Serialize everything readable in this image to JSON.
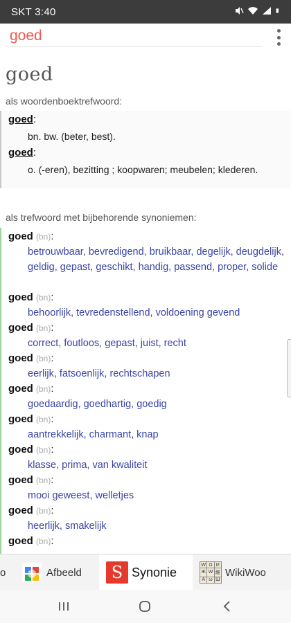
{
  "status": {
    "time": "SKT 3:40",
    "icons": [
      "mute-icon",
      "wifi-icon",
      "signal-icon",
      "battery-icon"
    ]
  },
  "appbar": {
    "search_query": "goed",
    "menu_icon": "more-vert-icon"
  },
  "headword": "goed",
  "dictionary": {
    "label": "als woordenboektrefwoord:",
    "entries": [
      {
        "term": "goed",
        "colon": ":",
        "definition": "bn. bw. (beter, best)."
      },
      {
        "term": "goed",
        "colon": ":",
        "definition": "o. (-eren), bezitting ; koopwaren; meubelen; klederen."
      }
    ]
  },
  "synonyms": {
    "label": "als trefwoord met bijbehorende synoniemen:",
    "groups": [
      {
        "term": "goed",
        "pos": "(bn)",
        "colon": ":",
        "synonyms": "betrouwbaar, bevredigend, bruikbaar, degelijk, deugdelijk, geldig, gepast, geschikt, handig, passend, proper, solide"
      },
      {
        "term": "goed",
        "pos": "(bn)",
        "colon": ":",
        "synonyms": "behoorlijk, tevredenstellend, voldoening gevend"
      },
      {
        "term": "goed",
        "pos": "(bn)",
        "colon": ":",
        "synonyms": "correct, foutloos, gepast, juist, recht"
      },
      {
        "term": "goed",
        "pos": "(bn)",
        "colon": ":",
        "synonyms": "eerlijk, fatsoenlijk, rechtschapen"
      },
      {
        "term": "goed",
        "pos": "(bn)",
        "colon": ":",
        "synonyms": "goedaardig, goedhartig, goedig"
      },
      {
        "term": "goed",
        "pos": "(bn)",
        "colon": ":",
        "synonyms": "aantrekkelijk, charmant, knap"
      },
      {
        "term": "goed",
        "pos": "(bn)",
        "colon": ":",
        "synonyms": "klasse, prima, van kwaliteit"
      },
      {
        "term": "goed",
        "pos": "(bn)",
        "colon": ":",
        "synonyms": "mooi geweest, welletjes"
      },
      {
        "term": "goed",
        "pos": "(bn)",
        "colon": ":",
        "synonyms": "heerlijk, smakelijk"
      },
      {
        "term": "goed",
        "pos": "(bn)",
        "colon": ":",
        "synonyms": ""
      }
    ]
  },
  "tabs": [
    {
      "label": "o",
      "icon": "none"
    },
    {
      "label": "Afbeeld",
      "icon": "google-images-icon"
    },
    {
      "label": "Synonie",
      "icon": "synoniemen-logo-icon",
      "active": true
    },
    {
      "label": "WikiWoo",
      "icon": "wiki-puzzle-icon"
    },
    {
      "label": "​",
      "icon": "none"
    }
  ],
  "wiki_logo_glyphs": [
    "W",
    "Ω",
    "И",
    "Ж",
    "W",
    "維",
    "A",
    "ω",
    "Ш"
  ],
  "navbar": [
    "recent-apps-icon",
    "home-icon",
    "back-icon"
  ],
  "colors": {
    "accent": "#f2574f",
    "synonym_text": "#3a45a8",
    "status_bar": "#3c3c3c",
    "synonym_border": "#9ad69a",
    "logo_red": "#e53a2b"
  }
}
